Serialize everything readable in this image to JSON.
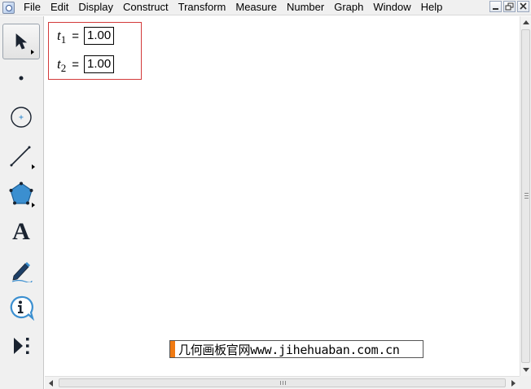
{
  "menubar": {
    "items": [
      "File",
      "Edit",
      "Display",
      "Construct",
      "Transform",
      "Measure",
      "Number",
      "Graph",
      "Window",
      "Help"
    ],
    "window_controls": [
      "minimize-icon",
      "restore-icon",
      "close-icon"
    ]
  },
  "toolbox": {
    "tools": [
      {
        "name": "arrow-tool",
        "icon": "arrow-icon",
        "selected": true
      },
      {
        "name": "point-tool",
        "icon": "point-icon"
      },
      {
        "name": "compass-tool",
        "icon": "circle-icon"
      },
      {
        "name": "straightedge-tool",
        "icon": "segment-icon"
      },
      {
        "name": "polygon-tool",
        "icon": "polygon-icon"
      },
      {
        "name": "text-tool",
        "icon": "text-icon",
        "glyph": "A"
      },
      {
        "name": "marker-tool",
        "icon": "pen-icon"
      },
      {
        "name": "information-tool",
        "icon": "info-icon",
        "glyph": "i"
      },
      {
        "name": "custom-tool",
        "icon": "custom-tool-icon"
      }
    ]
  },
  "parameters": [
    {
      "name": "t",
      "subscript": "1",
      "equals": "=",
      "value": "1.00"
    },
    {
      "name": "t",
      "subscript": "2",
      "equals": "=",
      "value": "1.00"
    }
  ],
  "watermark": {
    "text": "几何画板官网www.jihehuaban.com.cn"
  },
  "colors": {
    "selection_border": "#d33a3a",
    "watermark_accent": "#f07a12",
    "tool_blue": "#3b8fd0"
  }
}
